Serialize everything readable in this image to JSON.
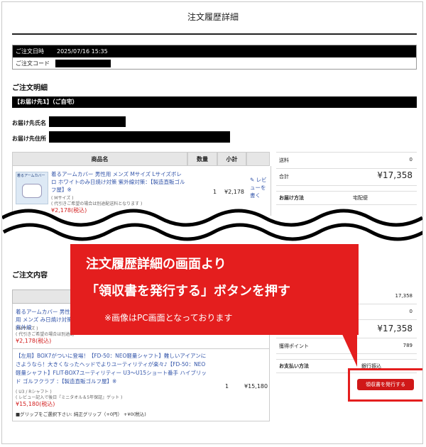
{
  "page": {
    "title": "注文履歴詳細"
  },
  "order_info": {
    "date_label": "ご注文日時",
    "date_value": "2025/07/16 15:35",
    "code_label": "ご注文コード"
  },
  "details": {
    "heading": "ご注文明細",
    "destination_bar": "【お届け先1】（ご自宅）",
    "name_label": "お届け先氏名",
    "address_label": "お届け先住所"
  },
  "items_table": {
    "headers": [
      "商品名",
      "数量",
      "小計"
    ],
    "row1": {
      "thumb_text": "着るアームカバー",
      "name": "着るアームカバー 男性用 メンズ Mサイズ Lサイズボレロ ホワイトのみ日焼け対策 紫外線対策：【製造直販ゴルフ屋】※",
      "size": "( Mサイズ )",
      "note": "( 代引きご希望の場合は別途配送料となります )",
      "price": "¥2,178(税込)",
      "qty": "1",
      "subtotal": "¥2,178",
      "review": "✎ レビューを書く"
    }
  },
  "summary_top": {
    "shipping_label": "送料",
    "shipping_value": "0",
    "total_label": "合計",
    "total_value": "¥17,358",
    "delivery_label": "お届け方法",
    "delivery_value": "宅配便"
  },
  "order_contents": {
    "heading": "ご注文内容",
    "item1": {
      "name": "着るアームカバー 男性用 メンズ み日焼け対策 紫外線",
      "size": "( Mサイズ )",
      "note": "( 代引きご希望の場合は別途配",
      "price": "¥2,178(税込)"
    },
    "item2": {
      "name": "【左用】BOX7がついに登場！【FD-50：NEO軽量シャフト】難しいアイアンにさようなら！大きくなったヘッドでよりユーティリティが楽々♪【FD-50：NEO軽量シャフト】FLIT-BOX7ユーティリティー U3〜U15ショート番手 ハイブリッド ゴルフクラブ ：【製造直販ゴルフ屋】※",
      "size": "( U3 / Rシャフト )",
      "note": "( レビュー記入で後日『ミニタオル＆5年保証』ゲット )",
      "price": "¥15,180(税込)",
      "grip": "■グリップをご選択下さい: 純正グリップ（+0円） +¥0(税込)",
      "qty": "1",
      "subtotal": "¥15,180"
    }
  },
  "summary_bottom": {
    "subtotal_value": "17,358",
    "shipping_value": "0",
    "total_value": "¥17,358",
    "points_label": "獲得ポイント",
    "points_value": "789",
    "payment_label": "お支払い方法",
    "payment_value": "銀行振込"
  },
  "receipt_button": {
    "label": "領収書を発行する"
  },
  "overlay": {
    "line1": "注文履歴詳細の画面より",
    "line2": "「領収書を発行する」ボタンを押す",
    "line3": "※画像はPC画面となっております"
  },
  "colors": {
    "accent_red": "#e41e1e",
    "button_red": "#d01818",
    "link_blue": "#3355aa"
  }
}
